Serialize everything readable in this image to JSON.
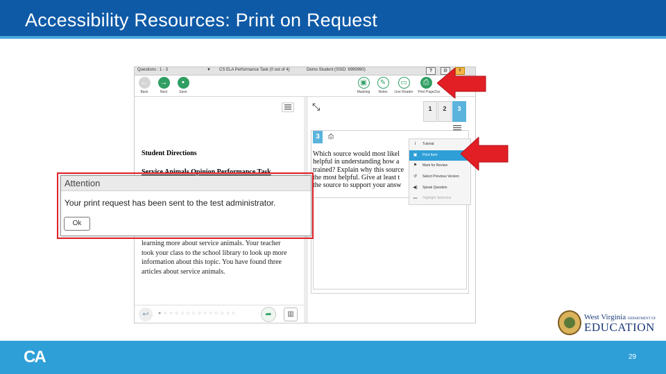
{
  "slide": {
    "title": "Accessibility Resources: Print on Request",
    "page_number": "29",
    "footer_logo": "CA"
  },
  "test_ui": {
    "topbar": {
      "questions": "Questions : 1 - 3",
      "test_name": "CS ELA Performance Task (0 out of 4)",
      "student": "Demo Student (SSID: 9999990)",
      "help": "?",
      "settings": "⚙",
      "pause": "II"
    },
    "toolbar": {
      "back": "Back",
      "next": "Next",
      "save": "Save",
      "masking": "Masking",
      "notes": "Notes",
      "line_reader": "Line Reader",
      "print_page": "Print Page",
      "zoom": "Zoo"
    },
    "left": {
      "heading": "Student Directions",
      "subheading": "Service Animals Opinion Performance Task",
      "body": "learning more about service animals. Your teacher took your class to the school library to look up more information about this topic. You have found three articles about service animals."
    },
    "right": {
      "tabs": [
        "1",
        "2",
        "3"
      ],
      "question_number": "3",
      "question_lines": [
        "Which source would most likel",
        "helpful in understanding how a",
        "trained? Explain why this source",
        "the most helpful. Give at least t",
        "the source to support your answ"
      ]
    },
    "context_menu": [
      {
        "icon": "i",
        "label": "Tutorial"
      },
      {
        "icon": "▣",
        "label": "Print Item"
      },
      {
        "icon": "⚑",
        "label": "Mark for Review"
      },
      {
        "icon": "↺",
        "label": "Select Previous Version"
      },
      {
        "icon": "◀)",
        "label": "Speak Question"
      },
      {
        "icon": "▬",
        "label": "Highlight Selection"
      }
    ],
    "bottom": {
      "dots": "● ○ ○ ○ ○ ○ ○ ○ ○ ○ ○ ○ ○ ○"
    }
  },
  "dialog": {
    "title": "Attention",
    "message": "Your print request has been sent to the test administrator.",
    "ok": "Ok"
  },
  "logo": {
    "line1": "West Virginia",
    "line1_small": "DEPARTMENT OF",
    "line2": "EDUCATION"
  },
  "colors": {
    "header": "#0e5aa7",
    "footer": "#2f9fd8",
    "highlight": "#e31f26"
  }
}
